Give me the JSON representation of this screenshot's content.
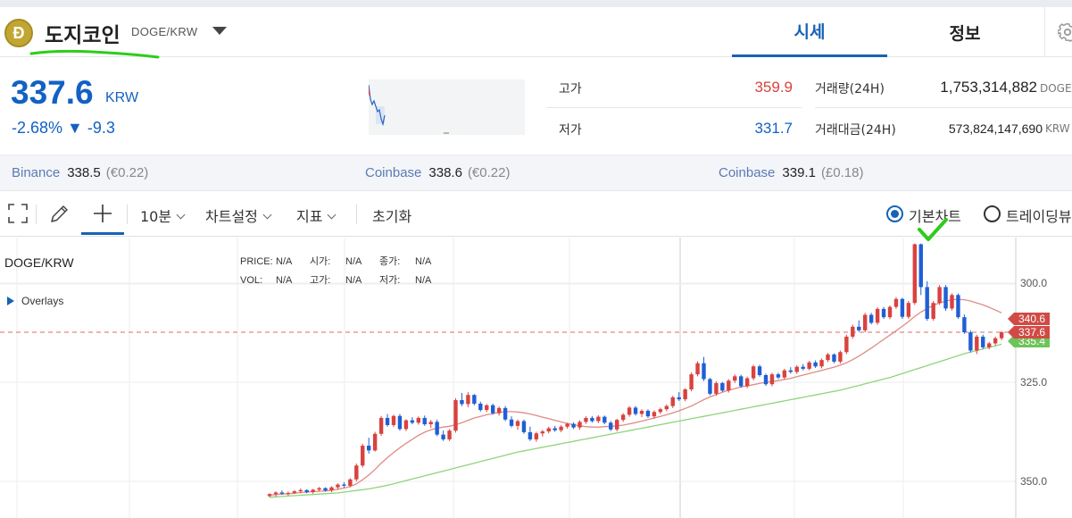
{
  "header": {
    "coin_icon_letter": "Ð",
    "coin_name": "도지코인",
    "pair": "DOGE/KRW",
    "tabs": [
      {
        "label": "시세",
        "active": true
      },
      {
        "label": "정보",
        "active": false
      }
    ]
  },
  "ticker": {
    "price": "337.6",
    "unit": "KRW",
    "change": "-2.68% ▼ -9.3"
  },
  "stats": {
    "high_label": "고가",
    "high_value": "359.9",
    "low_label": "저가",
    "low_value": "331.7",
    "volume_label": "거래량(24H)",
    "volume_value": "1,753,314,882",
    "volume_unit": "DOGE",
    "amount_label": "거래대금(24H)",
    "amount_value": "573,824,147,690",
    "amount_unit": "KRW"
  },
  "exchanges": [
    {
      "name": "Binance",
      "price": "338.5",
      "diff": "(€0.22)"
    },
    {
      "name": "Coinbase",
      "price": "338.6",
      "diff": "(€0.22)"
    },
    {
      "name": "Coinbase",
      "price": "339.1",
      "diff": "(£0.18)"
    }
  ],
  "toolbar": {
    "interval": "10분",
    "chart_settings": "차트설정",
    "indicators": "지표",
    "reset": "초기화",
    "radio_basic": "기본차트",
    "radio_tradingview": "트레이딩뷰"
  },
  "chart": {
    "title": "DOGE/KRW",
    "overlays_label": "Overlays",
    "ohlc_row1": [
      {
        "k": "PRICE:",
        "v": "N/A"
      },
      {
        "k": "시가:",
        "v": "N/A"
      },
      {
        "k": "종가:",
        "v": "N/A"
      }
    ],
    "ohlc_row2": [
      {
        "k": "VOL:",
        "v": "N/A"
      },
      {
        "k": "고가:",
        "v": "N/A"
      },
      {
        "k": "저가:",
        "v": "N/A"
      }
    ],
    "y_ticks": [
      "350.0",
      "325.0",
      "300.0"
    ],
    "price_tags": [
      "340.6",
      "337.6",
      "335.4"
    ]
  },
  "colors": {
    "accent": "#1763b6",
    "up": "#d9423f",
    "down": "#1f5fd6",
    "ma_short": "#e08b86",
    "ma_long": "#8fd47c",
    "highlight_green": "#2ecc1a"
  },
  "chart_data": {
    "type": "candlestick",
    "title": "DOGE/KRW",
    "ylim": [
      296,
      361
    ],
    "y_ticks": [
      300,
      325,
      350
    ],
    "current_price": 337.6,
    "price_tags": [
      340.6,
      337.6,
      335.4
    ],
    "candles_ohlc": [
      [
        296.3,
        297.0,
        296.0,
        296.8
      ],
      [
        296.8,
        297.5,
        296.2,
        297.2
      ],
      [
        297.2,
        297.7,
        296.6,
        296.9
      ],
      [
        296.9,
        297.4,
        296.4,
        297.1
      ],
      [
        297.1,
        297.8,
        296.8,
        297.5
      ],
      [
        297.5,
        298.2,
        297.0,
        297.8
      ],
      [
        297.8,
        298.0,
        297.0,
        297.3
      ],
      [
        297.3,
        298.1,
        296.9,
        297.9
      ],
      [
        297.9,
        298.6,
        297.5,
        298.3
      ],
      [
        298.3,
        298.5,
        297.4,
        297.7
      ],
      [
        297.7,
        298.8,
        297.3,
        298.5
      ],
      [
        298.5,
        299.5,
        298.0,
        299.2
      ],
      [
        299.2,
        299.8,
        298.4,
        298.9
      ],
      [
        298.9,
        300.8,
        298.5,
        300.5
      ],
      [
        300.5,
        304.5,
        300.0,
        304.0
      ],
      [
        304.0,
        309.5,
        303.5,
        309.0
      ],
      [
        309.0,
        311.0,
        307.0,
        307.8
      ],
      [
        307.8,
        312.5,
        307.5,
        312.0
      ],
      [
        312.0,
        316.5,
        311.5,
        316.0
      ],
      [
        316.0,
        317.0,
        313.8,
        314.2
      ],
      [
        314.2,
        316.8,
        313.7,
        316.5
      ],
      [
        316.5,
        317.0,
        312.8,
        313.2
      ],
      [
        313.2,
        315.7,
        312.7,
        315.4
      ],
      [
        315.4,
        316.2,
        314.4,
        314.8
      ],
      [
        314.8,
        316.4,
        314.3,
        316.0
      ],
      [
        316.0,
        316.6,
        314.0,
        314.4
      ],
      [
        314.4,
        315.5,
        313.5,
        315.0
      ],
      [
        315.0,
        315.6,
        311.4,
        311.8
      ],
      [
        311.8,
        312.8,
        310.2,
        310.6
      ],
      [
        310.6,
        313.2,
        310.2,
        312.8
      ],
      [
        312.8,
        321.0,
        312.3,
        320.5
      ],
      [
        320.5,
        322.3,
        319.0,
        319.5
      ],
      [
        319.5,
        322.5,
        318.7,
        321.8
      ],
      [
        321.8,
        322.0,
        319.2,
        319.6
      ],
      [
        319.6,
        320.1,
        317.6,
        318.0
      ],
      [
        318.0,
        319.5,
        317.5,
        319.2
      ],
      [
        319.2,
        319.6,
        316.8,
        317.2
      ],
      [
        317.2,
        318.9,
        316.6,
        318.5
      ],
      [
        318.5,
        319.0,
        315.2,
        315.6
      ],
      [
        315.6,
        316.4,
        313.6,
        314.0
      ],
      [
        314.0,
        315.6,
        313.0,
        315.2
      ],
      [
        315.2,
        315.6,
        312.0,
        312.4
      ],
      [
        312.4,
        313.8,
        310.2,
        310.6
      ],
      [
        310.6,
        312.5,
        310.0,
        312.1
      ],
      [
        312.1,
        313.0,
        311.3,
        312.6
      ],
      [
        312.6,
        313.8,
        312.1,
        313.4
      ],
      [
        313.4,
        314.0,
        312.5,
        312.9
      ],
      [
        312.9,
        314.2,
        312.4,
        313.8
      ],
      [
        313.8,
        314.8,
        313.3,
        314.5
      ],
      [
        314.5,
        314.9,
        313.2,
        313.6
      ],
      [
        313.6,
        315.4,
        313.0,
        315.0
      ],
      [
        315.0,
        316.4,
        314.5,
        316.0
      ],
      [
        316.0,
        316.5,
        314.8,
        315.2
      ],
      [
        315.2,
        316.7,
        314.7,
        316.3
      ],
      [
        316.3,
        316.6,
        314.4,
        314.8
      ],
      [
        314.8,
        315.2,
        312.7,
        313.1
      ],
      [
        313.1,
        315.8,
        312.6,
        315.5
      ],
      [
        315.5,
        317.2,
        315.0,
        316.8
      ],
      [
        316.8,
        319.0,
        316.3,
        318.6
      ],
      [
        318.6,
        319.0,
        316.6,
        317.0
      ],
      [
        317.0,
        318.2,
        316.2,
        317.8
      ],
      [
        317.8,
        318.2,
        316.0,
        316.4
      ],
      [
        316.4,
        317.9,
        315.8,
        317.5
      ],
      [
        317.5,
        318.6,
        317.0,
        318.2
      ],
      [
        318.2,
        319.4,
        317.7,
        319.0
      ],
      [
        319.0,
        321.6,
        318.5,
        321.2
      ],
      [
        321.2,
        322.5,
        320.3,
        320.7
      ],
      [
        320.7,
        323.5,
        320.2,
        323.2
      ],
      [
        323.2,
        327.5,
        322.7,
        327.0
      ],
      [
        327.0,
        330.3,
        326.5,
        329.8
      ],
      [
        329.8,
        331.4,
        325.3,
        325.8
      ],
      [
        325.8,
        326.1,
        321.7,
        322.1
      ],
      [
        322.1,
        325.2,
        321.6,
        324.8
      ],
      [
        324.8,
        325.1,
        322.5,
        322.9
      ],
      [
        322.9,
        325.8,
        322.4,
        325.4
      ],
      [
        325.4,
        327.0,
        324.8,
        326.5
      ],
      [
        326.5,
        326.9,
        323.6,
        324.0
      ],
      [
        324.0,
        326.4,
        323.5,
        326.0
      ],
      [
        326.0,
        329.4,
        325.5,
        329.0
      ],
      [
        329.0,
        329.4,
        326.4,
        326.8
      ],
      [
        326.8,
        327.2,
        324.1,
        324.5
      ],
      [
        324.5,
        327.4,
        324.0,
        327.0
      ],
      [
        327.0,
        327.4,
        325.8,
        326.2
      ],
      [
        326.2,
        328.4,
        325.7,
        328.0
      ],
      [
        328.0,
        328.8,
        327.2,
        327.6
      ],
      [
        327.6,
        329.3,
        327.1,
        328.9
      ],
      [
        328.9,
        329.6,
        328.0,
        328.4
      ],
      [
        328.4,
        330.4,
        328.0,
        330.0
      ],
      [
        330.0,
        330.5,
        328.6,
        329.0
      ],
      [
        329.0,
        331.0,
        328.5,
        330.6
      ],
      [
        330.6,
        332.4,
        330.1,
        332.0
      ],
      [
        332.0,
        332.3,
        329.8,
        330.2
      ],
      [
        330.2,
        333.0,
        329.7,
        332.6
      ],
      [
        332.6,
        337.0,
        332.1,
        336.5
      ],
      [
        336.5,
        339.5,
        336.0,
        339.0
      ],
      [
        339.0,
        340.6,
        337.7,
        338.1
      ],
      [
        338.1,
        342.5,
        337.6,
        342.0
      ],
      [
        342.0,
        342.5,
        339.6,
        340.0
      ],
      [
        340.0,
        343.9,
        339.5,
        343.5
      ],
      [
        343.5,
        344.0,
        341.0,
        341.4
      ],
      [
        341.4,
        344.4,
        340.9,
        344.0
      ],
      [
        344.0,
        346.5,
        343.5,
        346.0
      ],
      [
        346.0,
        346.3,
        341.0,
        341.5
      ],
      [
        341.5,
        345.5,
        341.0,
        345.0
      ],
      [
        345.0,
        360.0,
        344.5,
        359.8
      ],
      [
        359.8,
        360.0,
        347.0,
        349.0
      ],
      [
        349.0,
        350.5,
        340.5,
        341.0
      ],
      [
        341.0,
        345.5,
        340.5,
        345.0
      ],
      [
        345.0,
        349.5,
        344.5,
        349.0
      ],
      [
        349.0,
        349.5,
        343.0,
        343.6
      ],
      [
        343.6,
        347.4,
        343.1,
        347.0
      ],
      [
        347.0,
        347.4,
        341.0,
        341.4
      ],
      [
        341.4,
        342.1,
        337.2,
        337.6
      ],
      [
        337.6,
        338.1,
        332.5,
        333.0
      ],
      [
        333.0,
        337.0,
        332.1,
        336.5
      ],
      [
        336.5,
        337.0,
        333.4,
        333.8
      ],
      [
        333.8,
        335.2,
        333.3,
        334.8
      ],
      [
        334.8,
        336.5,
        334.3,
        336.1
      ],
      [
        336.1,
        337.9,
        335.6,
        337.6
      ]
    ],
    "ma_short": [
      296.5,
      296.7,
      296.8,
      296.9,
      297.0,
      297.2,
      297.3,
      297.4,
      297.5,
      297.6,
      297.8,
      298.0,
      298.3,
      298.7,
      299.4,
      300.4,
      301.6,
      303.0,
      304.6,
      306.0,
      307.3,
      308.5,
      309.6,
      310.6,
      311.6,
      312.4,
      313.0,
      313.4,
      313.7,
      313.9,
      314.3,
      314.8,
      315.4,
      316.0,
      316.4,
      316.8,
      317.1,
      317.4,
      317.6,
      317.6,
      317.5,
      317.3,
      317.0,
      316.6,
      316.2,
      315.8,
      315.4,
      315.0,
      314.6,
      314.3,
      314.0,
      313.8,
      313.7,
      313.7,
      313.8,
      313.9,
      314.0,
      314.2,
      314.5,
      314.8,
      315.2,
      315.6,
      316.0,
      316.4,
      316.8,
      317.3,
      317.8,
      318.4,
      319.0,
      319.8,
      320.6,
      321.3,
      321.9,
      322.5,
      323.0,
      323.4,
      323.8,
      324.1,
      324.4,
      324.7,
      325.0,
      325.2,
      325.4,
      325.7,
      326.0,
      326.4,
      326.8,
      327.2,
      327.6,
      328.0,
      328.4,
      328.8,
      329.3,
      329.9,
      330.7,
      331.6,
      332.6,
      333.6,
      334.7,
      335.8,
      336.9,
      338.0,
      339.1,
      340.3,
      341.6,
      342.7,
      343.6,
      344.4,
      345.0,
      345.5,
      345.8,
      345.9,
      345.8,
      345.5,
      345.0,
      344.5,
      343.9,
      343.2,
      342.5
    ],
    "ma_long": [
      296.0,
      296.1,
      296.2,
      296.3,
      296.4,
      296.5,
      296.6,
      296.7,
      296.8,
      296.9,
      297.0,
      297.1,
      297.3,
      297.5,
      297.7,
      297.9,
      298.1,
      298.4,
      298.7,
      299.0,
      299.4,
      299.8,
      300.2,
      300.6,
      301.0,
      301.4,
      301.8,
      302.2,
      302.6,
      303.0,
      303.4,
      303.8,
      304.2,
      304.6,
      305.0,
      305.4,
      305.8,
      306.2,
      306.6,
      307.0,
      307.4,
      307.7,
      308.0,
      308.3,
      308.6,
      308.9,
      309.2,
      309.5,
      309.8,
      310.1,
      310.4,
      310.7,
      311.0,
      311.3,
      311.6,
      311.9,
      312.2,
      312.5,
      312.8,
      313.1,
      313.4,
      313.7,
      314.0,
      314.3,
      314.6,
      314.9,
      315.2,
      315.5,
      315.8,
      316.1,
      316.4,
      316.7,
      317.0,
      317.3,
      317.6,
      317.9,
      318.2,
      318.5,
      318.8,
      319.1,
      319.4,
      319.7,
      320.0,
      320.3,
      320.6,
      320.9,
      321.2,
      321.5,
      321.8,
      322.1,
      322.4,
      322.7,
      323.0,
      323.4,
      323.8,
      324.2,
      324.6,
      325.0,
      325.4,
      325.8,
      326.2,
      326.7,
      327.2,
      327.7,
      328.2,
      328.7,
      329.2,
      329.7,
      330.2,
      330.7,
      331.2,
      331.7,
      332.2,
      332.6,
      333.0,
      333.4,
      333.8,
      334.2,
      334.6
    ]
  }
}
